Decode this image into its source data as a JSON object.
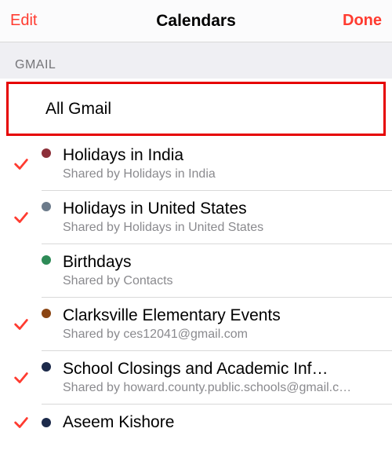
{
  "navbar": {
    "edit": "Edit",
    "title": "Calendars",
    "done": "Done"
  },
  "section": {
    "header": "GMAIL",
    "all_label": "All Gmail"
  },
  "accent_check": "#ff3b30",
  "items": [
    {
      "checked": true,
      "dot": "#8c2f39",
      "title": "Holidays in India",
      "subtitle": "Shared by Holidays in India"
    },
    {
      "checked": true,
      "dot": "#6c7b8b",
      "title": "Holidays in United States",
      "subtitle": "Shared by Holidays in United States"
    },
    {
      "checked": false,
      "dot": "#2e8b57",
      "title": "Birthdays",
      "subtitle": "Shared by Contacts"
    },
    {
      "checked": true,
      "dot": "#8b4513",
      "title": "Clarksville Elementary Events",
      "subtitle": "Shared by ces12041@gmail.com"
    },
    {
      "checked": true,
      "dot": "#1c2a4a",
      "title": "School Closings and Academic Inf…",
      "subtitle": "Shared by howard.county.public.schools@gmail.c…"
    },
    {
      "checked": true,
      "dot": "#1c2a4a",
      "title": "Aseem Kishore",
      "subtitle": null
    }
  ]
}
